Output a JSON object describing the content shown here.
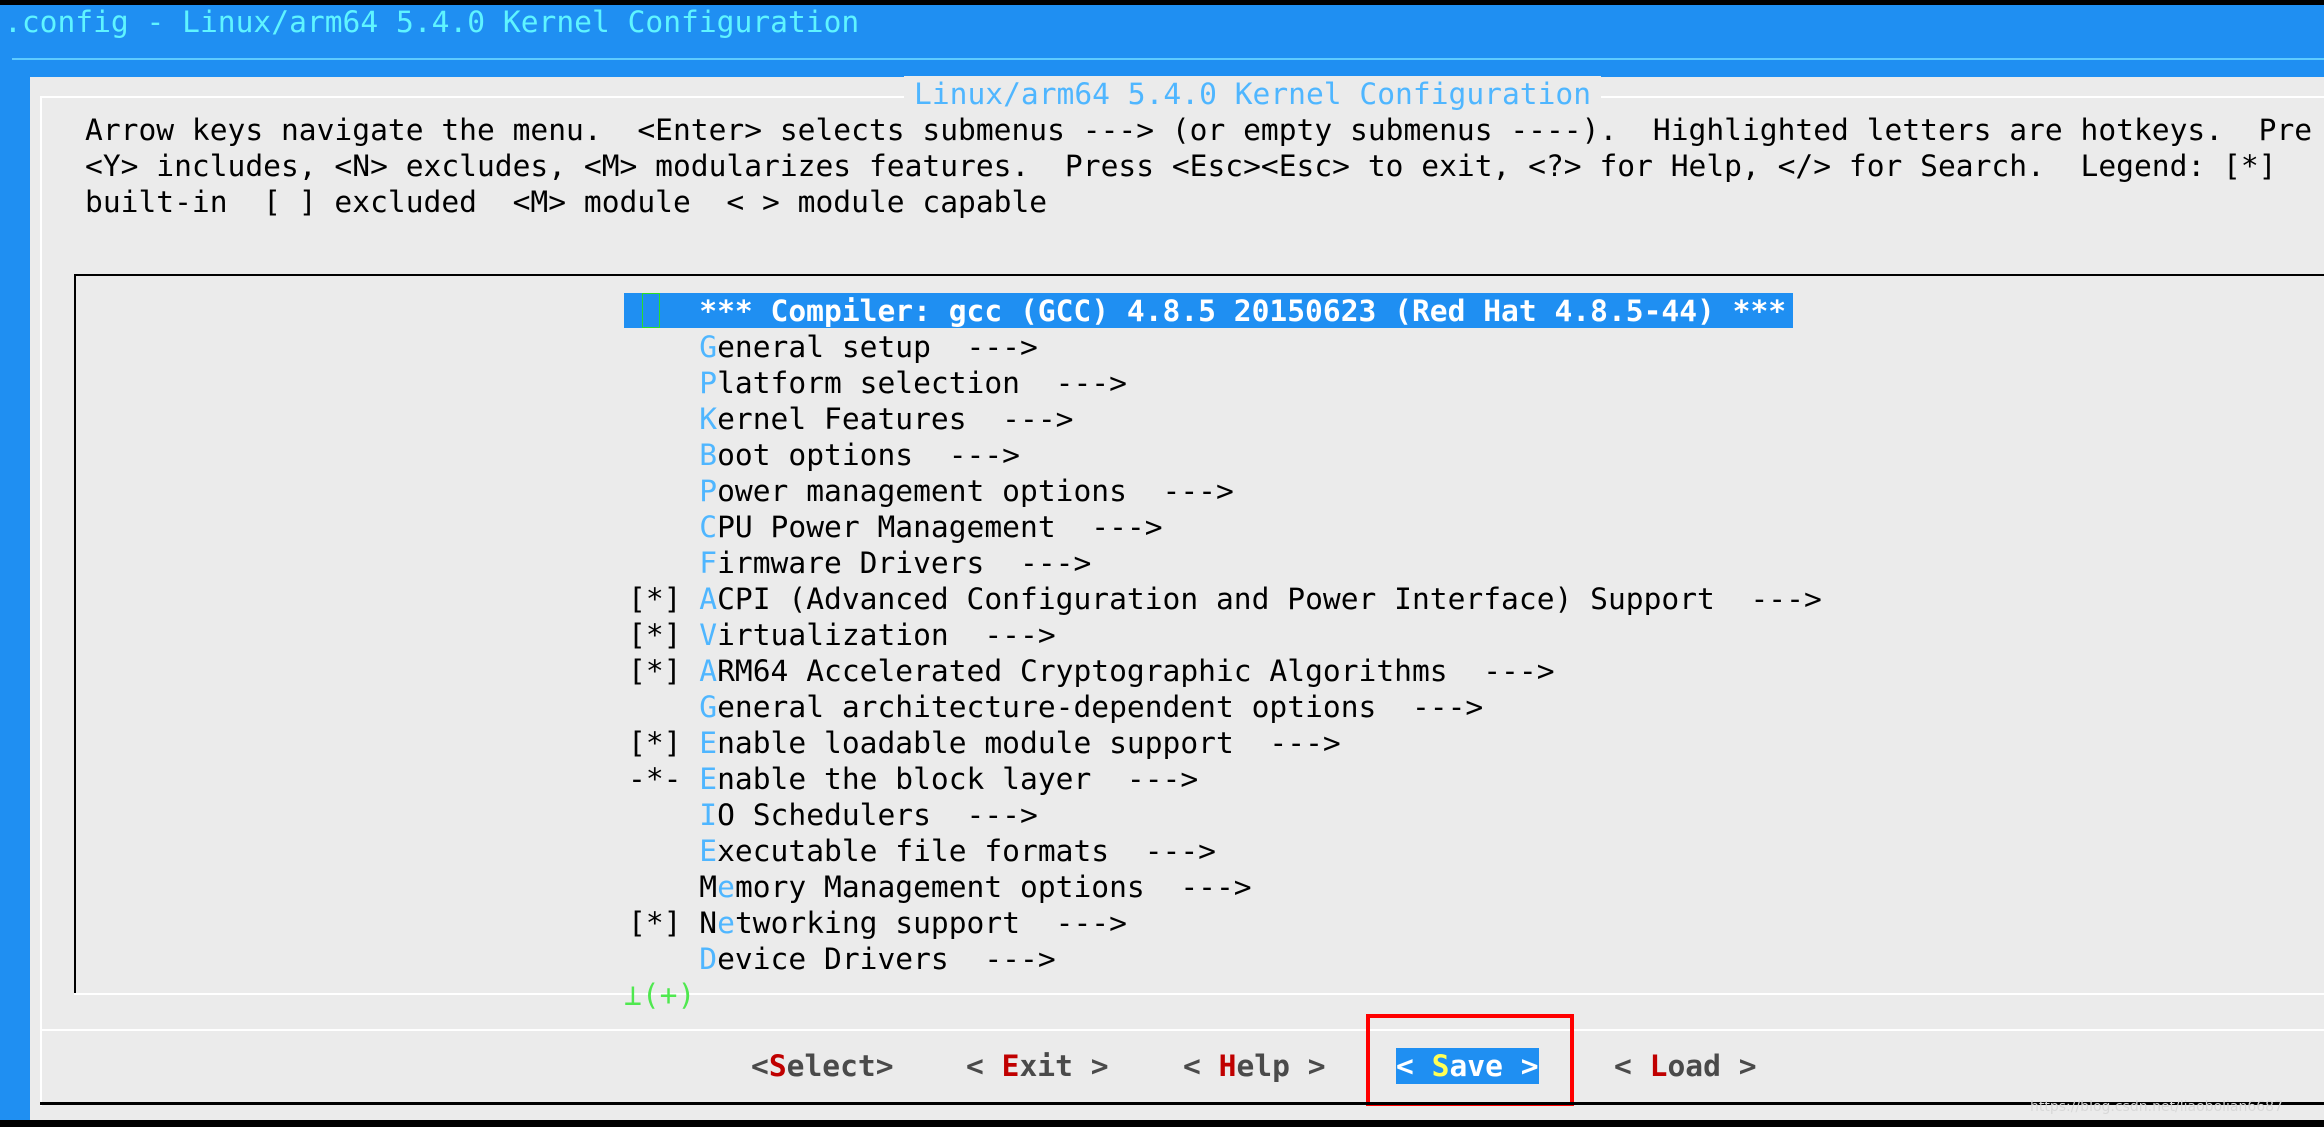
{
  "window_title": ".config - Linux/arm64 5.4.0 Kernel Configuration",
  "dialog_title": "Linux/arm64 5.4.0 Kernel Configuration",
  "help_lines": [
    "Arrow keys navigate the menu.  <Enter> selects submenus ---> (or empty submenus ----).  Highlighted letters are hotkeys.  Pre",
    "<Y> includes, <N> excludes, <M> modularizes features.  Press <Esc><Esc> to exit, <?> for Help, </> for Search.  Legend: [*]",
    "built-in  [ ] excluded  <M> module  < > module capable"
  ],
  "menu": {
    "selected_index": 0,
    "items": [
      {
        "prefix": "   ",
        "hot": "",
        "rest": "*** Compiler: gcc (GCC) 4.8.5 20150623 (Red Hat 4.8.5-44) ***"
      },
      {
        "prefix": "   ",
        "hot": "G",
        "rest": "eneral setup  --->"
      },
      {
        "prefix": "   ",
        "hot": "P",
        "rest": "latform selection  --->"
      },
      {
        "prefix": "   ",
        "hot": "K",
        "rest": "ernel Features  --->"
      },
      {
        "prefix": "   ",
        "hot": "B",
        "rest": "oot options  --->"
      },
      {
        "prefix": "   ",
        "hot": "P",
        "rest": "ower management options  --->"
      },
      {
        "prefix": "   ",
        "hot": "C",
        "rest": "PU Power Management  --->"
      },
      {
        "prefix": "   ",
        "hot": "F",
        "rest": "irmware Drivers  --->"
      },
      {
        "prefix": "[*]",
        "hot": "A",
        "rest": "CPI (Advanced Configuration and Power Interface) Support  --->"
      },
      {
        "prefix": "[*]",
        "hot": "V",
        "rest": "irtualization  --->"
      },
      {
        "prefix": "[*]",
        "hot": "A",
        "rest": "RM64 Accelerated Cryptographic Algorithms  --->"
      },
      {
        "prefix": "   ",
        "hot": "G",
        "rest": "eneral architecture-dependent options  --->"
      },
      {
        "prefix": "[*]",
        "hot": "E",
        "rest": "nable loadable module support  --->"
      },
      {
        "prefix": "-*-",
        "hot": "E",
        "rest": "nable the block layer  --->"
      },
      {
        "prefix": "   ",
        "hot": "I",
        "rest": "O Schedulers  --->"
      },
      {
        "prefix": "   ",
        "hot": "E",
        "rest": "xecutable file formats  --->"
      },
      {
        "prefix": "   ",
        "hot": "M",
        "rest": "emory Management options  --->",
        "hot_pos": 1
      },
      {
        "prefix": "[*]",
        "hot": "N",
        "rest": "etworking support  --->",
        "hot_pos": 1
      },
      {
        "prefix": "   ",
        "hot": "D",
        "rest": "evice Drivers  --->"
      }
    ],
    "more_indicator": "(+)"
  },
  "buttons": [
    {
      "open": "<",
      "hot": "S",
      "rest": "elect",
      "close": ">"
    },
    {
      "open": "< ",
      "hot": "E",
      "rest": "xit",
      "close": " >"
    },
    {
      "open": "< ",
      "hot": "H",
      "rest": "elp",
      "close": " >"
    },
    {
      "open": "< ",
      "hot": "S",
      "rest": "ave",
      "close": " >"
    },
    {
      "open": "< ",
      "hot": "L",
      "rest": "oad",
      "close": " >"
    }
  ],
  "selected_button": 3,
  "watermark": "https://blog.csdn.net/liaobolian6687",
  "colors": {
    "background": "#1f8ff2",
    "panel": "#ebebeb",
    "hotkey": "#4fb6ff",
    "button_hotkey": "#c00000",
    "annotation_box": "#ff0000"
  }
}
